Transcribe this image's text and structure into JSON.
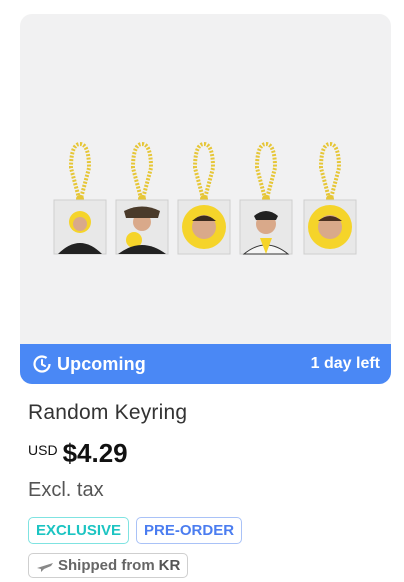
{
  "product": {
    "title": "Random Keyring",
    "currency": "USD",
    "price": "$4.29",
    "tax_note": "Excl. tax"
  },
  "status": {
    "label": "Upcoming",
    "time_left": "1 day left",
    "color": "#4a88f5"
  },
  "badges": {
    "exclusive": "EXCLUSIVE",
    "preorder": "PRE-ORDER"
  },
  "shipping": {
    "prefix": "Shipped from",
    "origin": "KR"
  },
  "icons": {
    "status": "clock-icon",
    "shipping": "airplane-icon"
  }
}
